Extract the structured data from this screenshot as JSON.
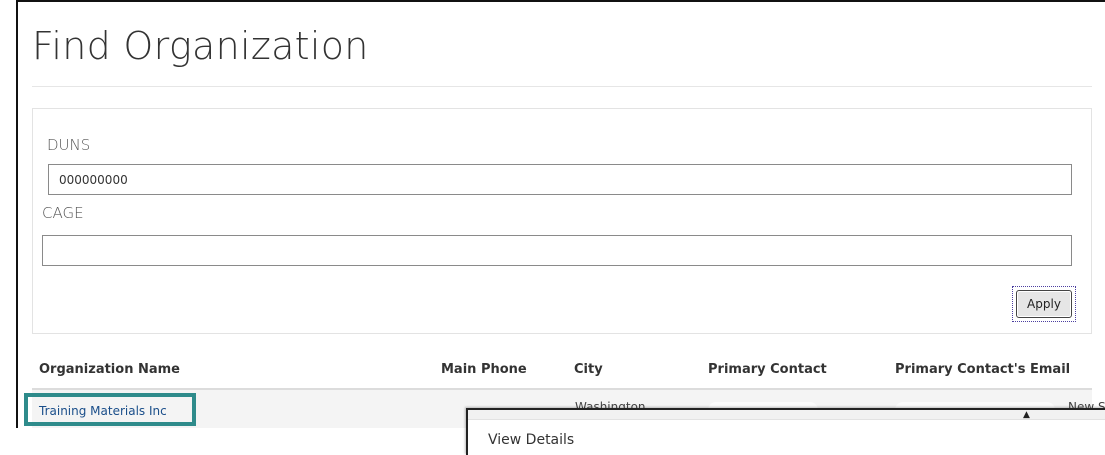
{
  "page": {
    "title": "Find Organization"
  },
  "filters": {
    "duns": {
      "label": "DUNS",
      "value": "000000000"
    },
    "cage": {
      "label": "CAGE",
      "value": ""
    },
    "apply_label": "Apply"
  },
  "table": {
    "columns": [
      "Organization Name",
      "Main Phone",
      "City",
      "Primary Contact",
      "Primary Contact's Email"
    ],
    "rows": [
      {
        "organization_name": "Training Materials Inc",
        "city": "Washington",
        "trailing": "New S"
      }
    ]
  },
  "context_menu": {
    "items": [
      "View Details"
    ]
  },
  "colors": {
    "highlight": "#2e8b8b",
    "link": "#1a4e8a"
  }
}
